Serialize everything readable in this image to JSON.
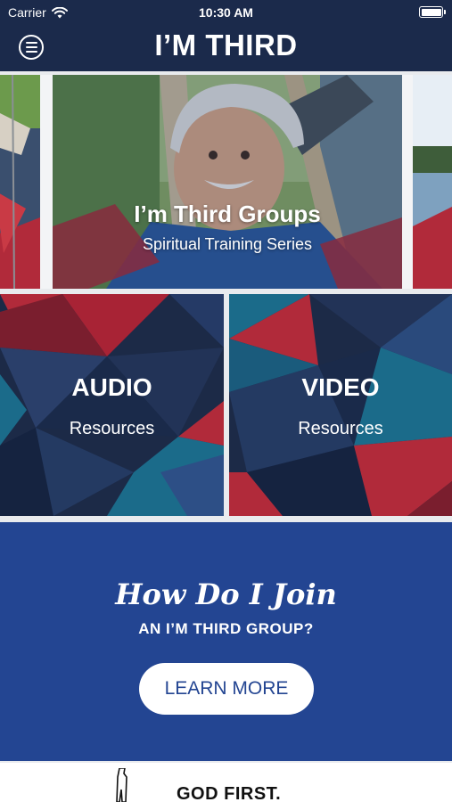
{
  "status_bar": {
    "carrier": "Carrier",
    "time": "10:30 AM"
  },
  "header": {
    "title": "I’M THIRD"
  },
  "carousel": {
    "main": {
      "title": "I’m Third Groups",
      "subtitle": "Spiritual Training Series"
    }
  },
  "tiles": [
    {
      "title": "AUDIO",
      "subtitle": "Resources"
    },
    {
      "title": "VIDEO",
      "subtitle": "Resources"
    }
  ],
  "join": {
    "script_title": "How Do I Join",
    "subtitle": "AN I’M THIRD GROUP?",
    "button_label": "LEARN MORE"
  },
  "footer": {
    "motto": "GOD FIRST."
  },
  "colors": {
    "navy": "#1b2a4b",
    "royal_blue": "#234592",
    "red": "#b12a3a",
    "teal": "#1b6b8a"
  },
  "icons": [
    "wifi-icon",
    "battery-icon",
    "menu-icon"
  ]
}
